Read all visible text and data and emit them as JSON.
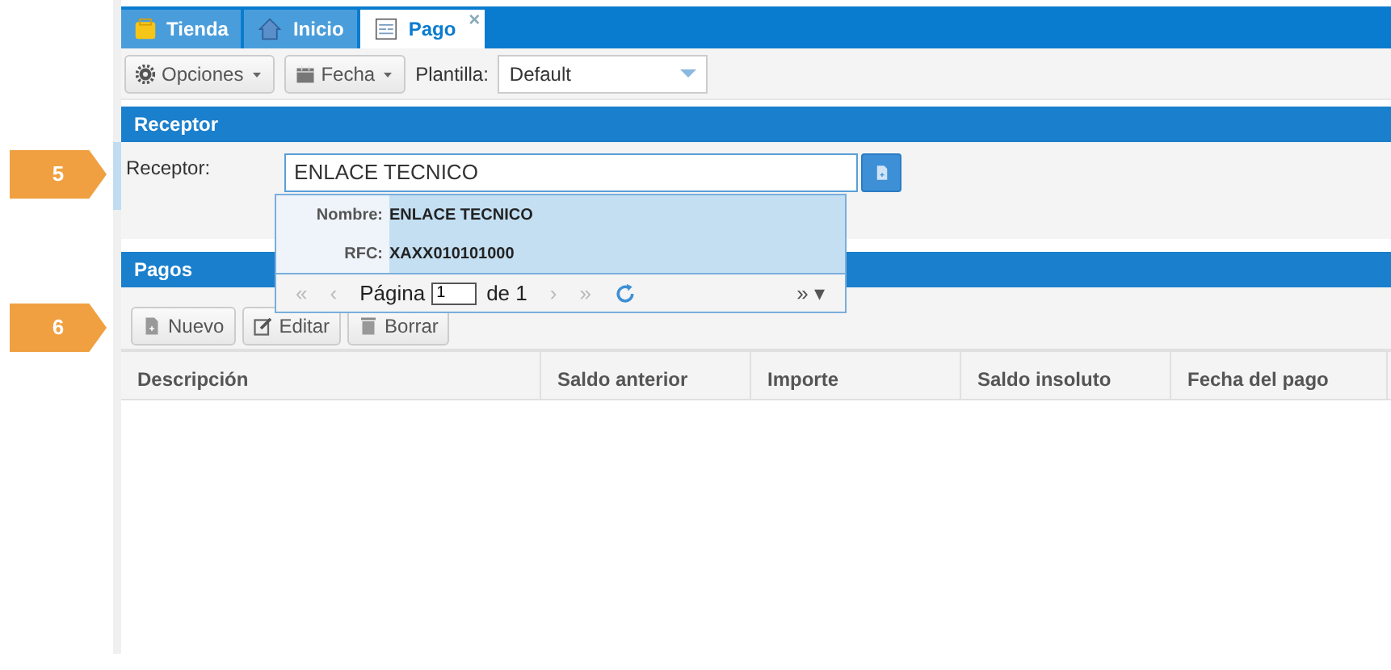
{
  "step_markers": [
    {
      "label": "5"
    },
    {
      "label": "6"
    }
  ],
  "tabs": [
    {
      "label": "Tienda",
      "kind": "store",
      "selected": false
    },
    {
      "label": "Inicio",
      "kind": "home",
      "selected": false
    },
    {
      "label": "Pago",
      "kind": "form",
      "selected": true,
      "close": "×"
    }
  ],
  "toolbar": {
    "buttons": [
      {
        "label": "Opciones",
        "kind": "gear"
      },
      {
        "label": "Fecha",
        "kind": "calendar"
      }
    ],
    "template_label": "Plantilla:",
    "template_value": "Default"
  },
  "receptor_panel": {
    "title": "Receptor",
    "label": "Receptor:",
    "value": "ENLACE TECNICO"
  },
  "suggestions": {
    "rows": [
      {
        "label": "Nombre:",
        "value": "ENLACE TECNICO",
        "selected": true
      },
      {
        "label": "RFC:",
        "value": "XAXX010101000",
        "selected": true
      }
    ],
    "pager": {
      "first": "«",
      "previous": "‹",
      "page_label": "Página",
      "page": "1",
      "of": "de 1",
      "next": "›",
      "last": "»",
      "more": "» ▾"
    }
  },
  "pagos_panel": {
    "title": "Pagos",
    "buttons": [
      {
        "label": "Nuevo",
        "kind": "new"
      },
      {
        "label": "Editar",
        "kind": "edit"
      },
      {
        "label": "Borrar",
        "kind": "delete"
      }
    ],
    "columns": [
      "Descripción",
      "Saldo anterior",
      "Importe",
      "Saldo insoluto",
      "Fecha del pago"
    ]
  }
}
